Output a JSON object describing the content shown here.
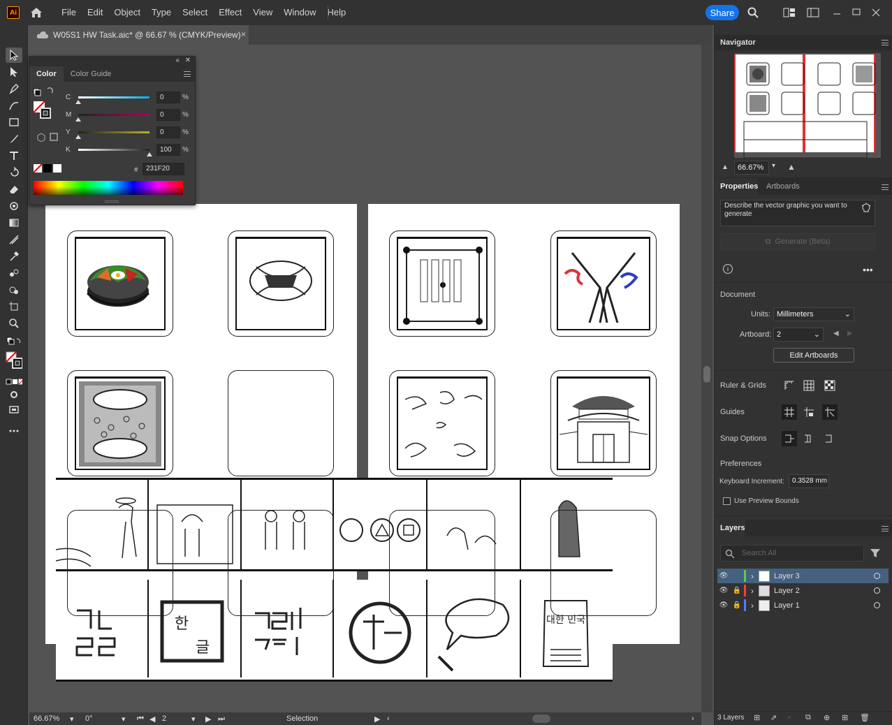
{
  "app": {
    "logo": "Ai"
  },
  "menu": [
    "File",
    "Edit",
    "Object",
    "Type",
    "Select",
    "Effect",
    "View",
    "Window",
    "Help"
  ],
  "share_label": "Share",
  "document_tab": {
    "title": "W05S1 HW Task.aic* @ 66.67 % (CMYK/Preview)",
    "close": "×"
  },
  "color_panel": {
    "tabs": [
      "Color",
      "Color Guide"
    ],
    "channels": [
      {
        "label": "C",
        "value": "0",
        "unit": "%"
      },
      {
        "label": "M",
        "value": "0",
        "unit": "%"
      },
      {
        "label": "Y",
        "value": "0",
        "unit": "%"
      },
      {
        "label": "K",
        "value": "100",
        "unit": "%"
      }
    ],
    "hex_prefix": "#",
    "hex_value": "231F20"
  },
  "navigator": {
    "title": "Navigator",
    "zoom": "66.67%"
  },
  "properties": {
    "tabs": [
      "Properties",
      "Artboards"
    ],
    "generate_prompt": "Describe the vector graphic you want to generate",
    "generate_button": "Generate (Beta)",
    "document_section": "Document",
    "units_label": "Units:",
    "units_value": "Millimeters",
    "artboard_label": "Artboard:",
    "artboard_value": "2",
    "edit_artboards": "Edit Artboards",
    "ruler_grids": "Ruler & Grids",
    "guides": "Guides",
    "snap_options": "Snap Options",
    "preferences": "Preferences",
    "keyboard_increment_label": "Keyboard Increment:",
    "keyboard_increment_value": "0.3528 mm",
    "use_preview_bounds": "Use Preview Bounds"
  },
  "layers": {
    "title": "Layers",
    "search_placeholder": "Search All",
    "items": [
      {
        "name": "Layer 3",
        "color": "#4fd34f",
        "selected": true,
        "locked": false
      },
      {
        "name": "Layer 2",
        "color": "#ff3b3b",
        "selected": false,
        "locked": true
      },
      {
        "name": "Layer 1",
        "color": "#4f7bff",
        "selected": false,
        "locked": true
      }
    ],
    "count": "3 Layers"
  },
  "status": {
    "zoom": "66.67%",
    "rotation": "0°",
    "artboard": "2",
    "tool": "Selection"
  },
  "canvas_text": {
    "korean_tile_1": "대한\n민국",
    "korean_tile_2a": "한",
    "korean_tile_2b": "글"
  }
}
